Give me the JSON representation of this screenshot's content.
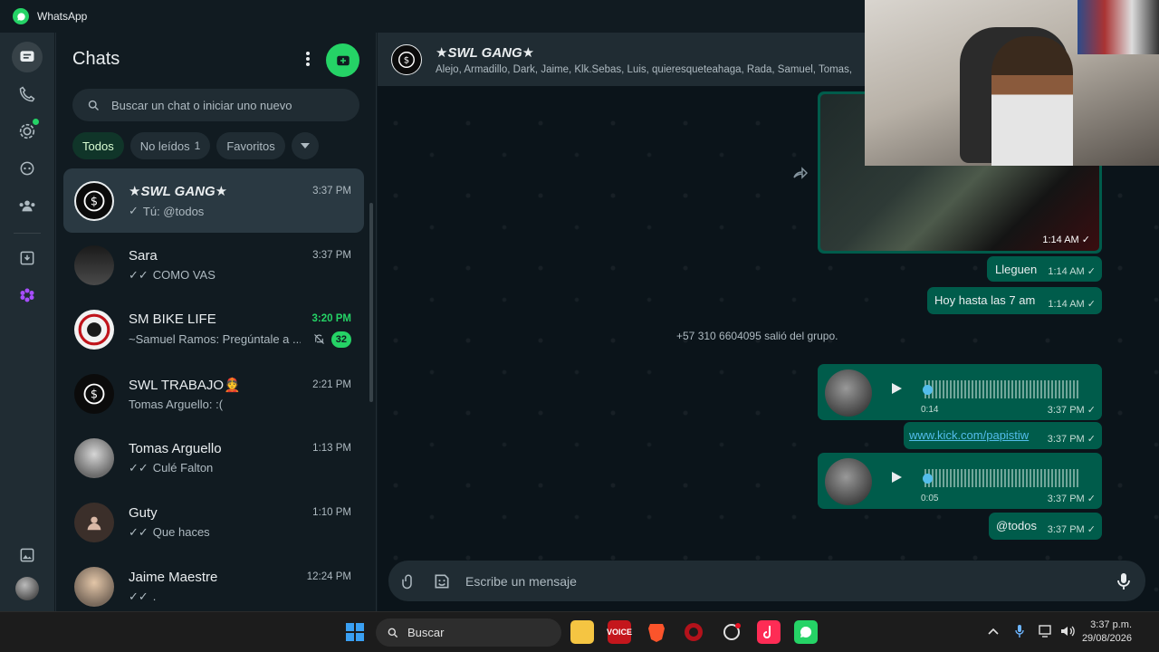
{
  "app": {
    "title": "WhatsApp"
  },
  "colors": {
    "accent": "#25d366",
    "bubble_out": "#005c4b",
    "panel": "#202c33",
    "bg": "#111b21"
  },
  "sidebar": {
    "title": "Chats",
    "search_placeholder": "Buscar un chat o iniciar uno nuevo",
    "filters": [
      {
        "label": "Todos",
        "active": true
      },
      {
        "label": "No leídos",
        "count": "1"
      },
      {
        "label": "Favoritos"
      }
    ],
    "chats": [
      {
        "name": "★SWL GANG★",
        "time": "3:37 PM",
        "preview": "Tú: @todos",
        "status": "✓"
      },
      {
        "name": "Sara",
        "time": "3:37 PM",
        "preview": "COMO VAS",
        "status": "✓✓"
      },
      {
        "name": "SM BIKE LIFE",
        "time": "3:20 PM",
        "preview": "~Samuel Ramos: Pregúntale a ...",
        "unread": "32"
      },
      {
        "name": "SWL TRABAJO👲",
        "time": "2:21 PM",
        "preview": "Tomas Arguello: :("
      },
      {
        "name": "Tomas Arguello",
        "time": "1:13 PM",
        "preview": "Culé Falton",
        "status": "✓✓"
      },
      {
        "name": "Guty",
        "time": "1:10 PM",
        "preview": "Que haces",
        "status": "✓✓"
      },
      {
        "name": "Jaime Maestre",
        "time": "12:24 PM",
        "preview": ".",
        "status": "✓✓"
      }
    ]
  },
  "chat": {
    "group_name": "★SWL GANG★",
    "members": "Alejo, Armadillo, Dark, Jaime, Klk.Sebas, Luis, quieresqueteahaga, Rada, Samuel, Tomas,",
    "messages": {
      "media_time": "1:14 AM ✓",
      "m1_text": "Lleguen",
      "m1_time": "1:14 AM ✓",
      "m2_text": "Hoy hasta las 7 am",
      "m2_time": "1:14 AM ✓",
      "system": "+57 310 6604095 salió del grupo.",
      "a1_dur": "0:14",
      "a1_time": "3:37 PM ✓",
      "link_text": "www.kick.com/papistiw",
      "link_time": "3:37 PM ✓",
      "a2_dur": "0:05",
      "a2_time": "3:37 PM ✓",
      "m3_text": "@todos",
      "m3_time": "3:37 PM ✓"
    },
    "composer_placeholder": "Escribe un mensaje"
  },
  "taskbar": {
    "search_placeholder": "Buscar",
    "voice_app": "VOICE",
    "clock_time": "3:37 p.m.",
    "clock_date": "29/08/2026"
  }
}
